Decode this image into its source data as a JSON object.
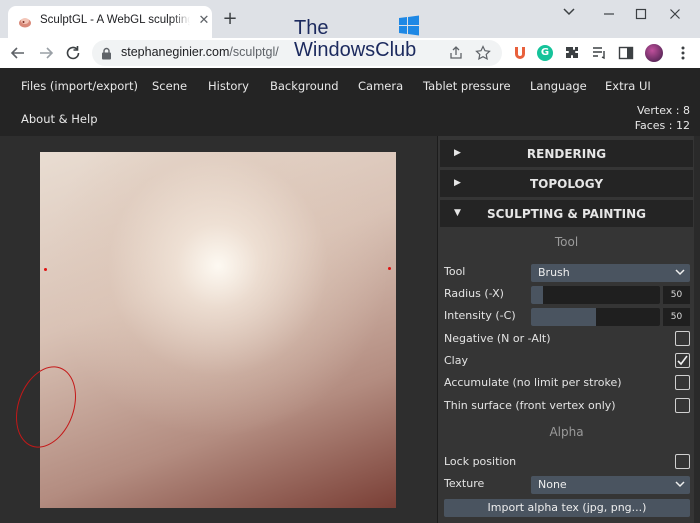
{
  "browser": {
    "tab_title": "SculptGL - A WebGL sculpting app",
    "new_tab_symbol": "+",
    "close_symbol": "✕",
    "url_host": "stephaneginier.com",
    "url_path": "/sculptgl/",
    "extension_c": "G"
  },
  "watermark": {
    "line1": "The",
    "line2": "WindowsClub"
  },
  "menu": {
    "items": [
      "Files (import/export)",
      "Scene",
      "History",
      "Background",
      "Camera",
      "Tablet pressure",
      "Language",
      "Extra UI"
    ],
    "second_row": [
      "About & Help"
    ],
    "vertex_text": "Vertex : 8",
    "faces_text": "Faces : 12"
  },
  "panel": {
    "sections": [
      {
        "label": "RENDERING",
        "arrow": "▶"
      },
      {
        "label": "TOPOLOGY",
        "arrow": "▶"
      },
      {
        "label": "SCULPTING & PAINTING",
        "arrow": "▼"
      }
    ],
    "tool_group_title": "Tool",
    "tool": {
      "label": "Tool",
      "value": "Brush"
    },
    "radius": {
      "label": "Radius (-X)",
      "value": "50",
      "fill_fraction": 0.09
    },
    "intensity": {
      "label": "Intensity (-C)",
      "value": "50",
      "fill_fraction": 0.5
    },
    "checks": [
      {
        "label": "Negative (N or -Alt)",
        "checked": false
      },
      {
        "label": "Clay",
        "checked": true
      },
      {
        "label": "Accumulate (no limit per stroke)",
        "checked": false
      },
      {
        "label": "Thin surface (front vertex only)",
        "checked": false
      }
    ],
    "alpha_group_title": "Alpha",
    "lock_position": {
      "label": "Lock position",
      "checked": false
    },
    "texture": {
      "label": "Texture",
      "value": "None"
    },
    "import_button": "Import alpha tex (jpg, png...)"
  },
  "colors": {
    "menu_bg": "#242424",
    "panel_bg": "#353535",
    "control_bg": "#4a5460",
    "stroke_red": "#c41818"
  }
}
